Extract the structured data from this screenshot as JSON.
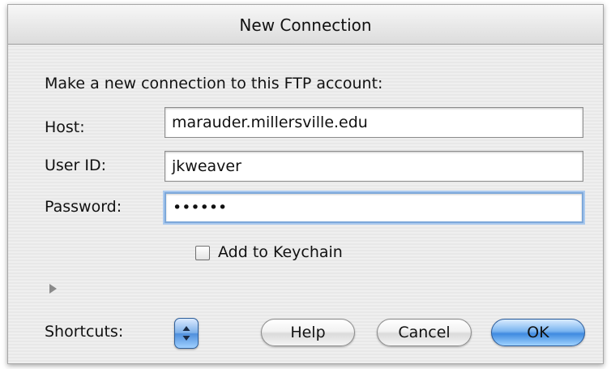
{
  "dialog": {
    "title": "New Connection",
    "prompt": "Make a new connection to this FTP account:"
  },
  "fields": {
    "host": {
      "label": "Host:",
      "value": "marauder.millersville.edu"
    },
    "user_id": {
      "label": "User ID:",
      "value": "jkweaver"
    },
    "password": {
      "label": "Password:",
      "value": "••••••"
    }
  },
  "keychain": {
    "label": "Add to Keychain",
    "checked": false
  },
  "shortcuts": {
    "label": "Shortcuts:"
  },
  "buttons": {
    "help": "Help",
    "cancel": "Cancel",
    "ok": "OK"
  },
  "icons": {
    "disclosure": "disclosure-triangle-icon",
    "stepper": "popup-arrows-icon"
  },
  "colors": {
    "accent": "#4f8fdc",
    "focus_ring": "#7da8da"
  }
}
